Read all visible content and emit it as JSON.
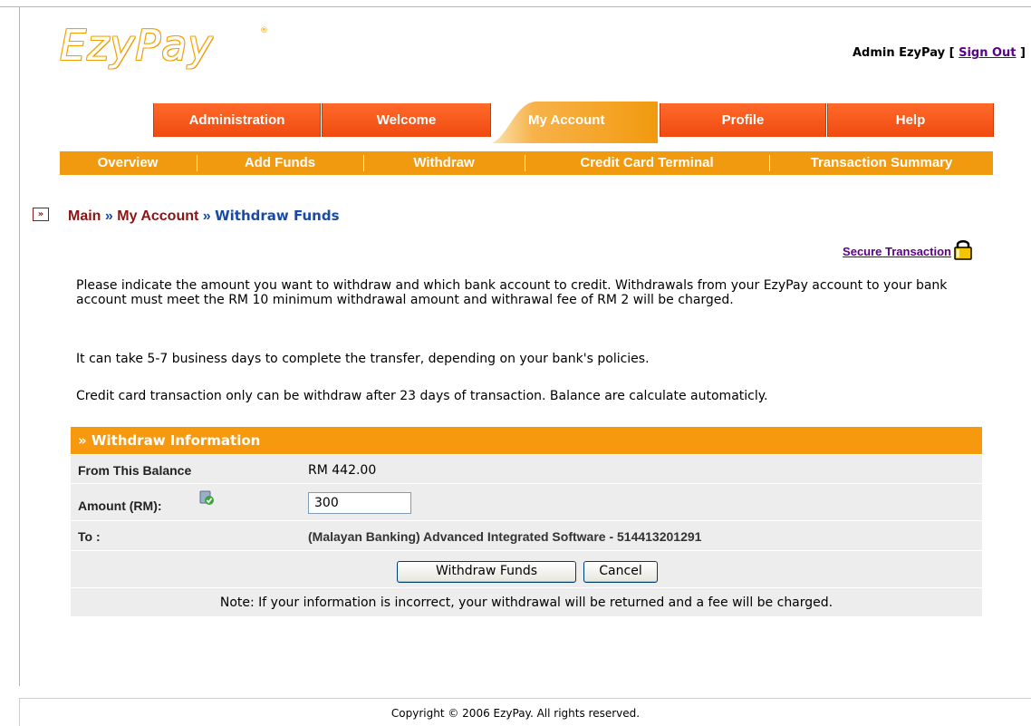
{
  "logo": {
    "text": "EzyPay",
    "reg": "®"
  },
  "user": {
    "name": "Admin EzyPay",
    "open_bracket": "[",
    "sign_out": "Sign Out",
    "close_bracket": "]"
  },
  "tabs": [
    {
      "label": "Administration",
      "active": false
    },
    {
      "label": "Welcome",
      "active": false
    },
    {
      "label": "My Account",
      "active": true
    },
    {
      "label": "Profile",
      "active": false
    },
    {
      "label": "Help",
      "active": false
    }
  ],
  "subnav": [
    {
      "label": "Overview"
    },
    {
      "label": "Add Funds"
    },
    {
      "label": "Withdraw"
    },
    {
      "label": "Credit Card Terminal"
    },
    {
      "label": "Transaction Summary"
    }
  ],
  "breadcrumb": {
    "icon": "»",
    "main": "Main",
    "sep1": " » ",
    "section": "My Account",
    "sep2": " » ",
    "current": "Withdraw Funds"
  },
  "secure": {
    "label": "Secure Transaction",
    "icon": "lock-icon"
  },
  "paragraphs": {
    "p1": "Please indicate the amount you want to withdraw and which bank account to credit. Withdrawals from your EzyPay account to your bank account must meet the RM 10 minimum withdrawal amount and withrawal fee of RM 2 will be charged.",
    "p2": "It can take 5-7 business days to complete the transfer, depending on your bank's policies.",
    "p3": "Credit card transaction only can be withdraw after 23 days of transaction. Balance are calculate automaticly."
  },
  "withdraw": {
    "header": "» Withdraw Information",
    "balance_label": "From This Balance",
    "balance_value": "RM 442.00",
    "amount_label": "Amount (RM):",
    "amount_value": "300",
    "to_label": "To :",
    "to_value": "(Malayan Banking) Advanced Integrated Software - 514413201291",
    "submit_label": "Withdraw Funds",
    "cancel_label": "Cancel",
    "note": "Note: If your information is incorrect, your withdrawal will be returned and a fee will be charged."
  },
  "footer": {
    "copyright": "Copyright © 2006 EzyPay. All rights reserved."
  },
  "colors": {
    "orange": "#f29a0f",
    "tab_red": "#f04a10",
    "link_purple": "#5a0088",
    "crumb_red": "#8b1414",
    "crumb_blue": "#1a4aa8"
  }
}
